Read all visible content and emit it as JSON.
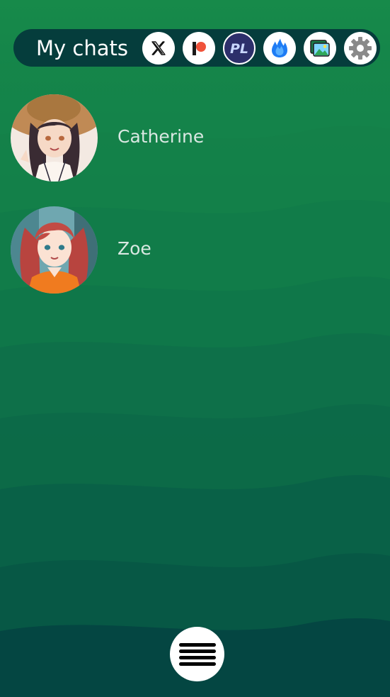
{
  "header": {
    "title": "My chats",
    "icons": [
      "x-logo-icon",
      "patreon-icon",
      "pl-badge-icon",
      "flame-icon",
      "gallery-icon",
      "gear-icon"
    ],
    "pl_text": "PL"
  },
  "chats": [
    {
      "name": "Catherine",
      "avatar": "avatar-catherine"
    },
    {
      "name": "Zoe",
      "avatar": "avatar-zoe"
    }
  ],
  "fab": {
    "icon": "hamburger-menu-icon"
  },
  "colors": {
    "bg_top": "#178a4a",
    "bg_bottom": "#023c40",
    "topbar": "#053d3c",
    "chat_name": "#d9e8e2",
    "flame": "#1e7cf5",
    "gear": "#8a8a8a"
  }
}
